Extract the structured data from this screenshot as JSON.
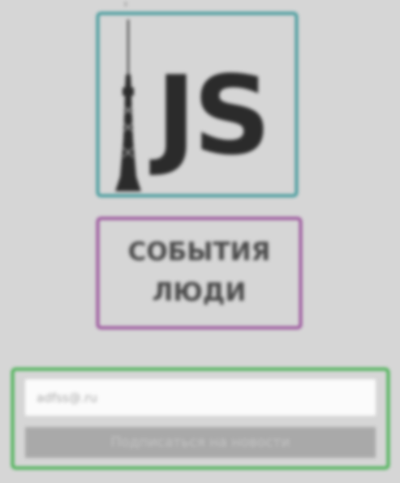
{
  "logo": {
    "text": "JS",
    "icon": "tv-tower-icon"
  },
  "nav": {
    "items": [
      {
        "label": "События"
      },
      {
        "label": "Люди"
      }
    ]
  },
  "subscribe": {
    "email_placeholder": "adfss@.ru",
    "button_label": "Подписаться на новости"
  },
  "colors": {
    "background": "#d6d6d6",
    "logo_border": "#1b8a8c",
    "nav_border": "#8a2f8c",
    "subscribe_border": "#22a830",
    "button_bg": "#a9a9a9"
  }
}
